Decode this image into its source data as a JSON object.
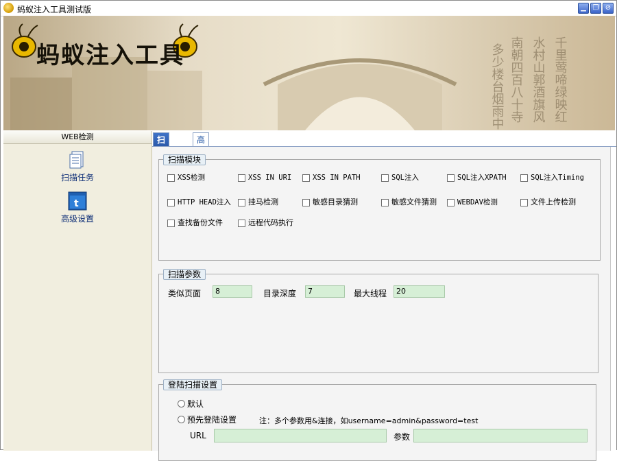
{
  "window": {
    "title": "蚂蚁注入工具测试版",
    "controls": [
      "minimize",
      "maximize",
      "close"
    ]
  },
  "banner": {
    "logo_text": "蚂蚁注入工具"
  },
  "sidebar": {
    "header": "WEB检测",
    "items": [
      {
        "label": "扫描任务",
        "icon": "document-icon"
      },
      {
        "label": "高级设置",
        "icon": "settings-window-icon"
      }
    ]
  },
  "tabs": [
    {
      "label": "扫描任务",
      "active": true
    },
    {
      "label": "高级设置",
      "active": false
    }
  ],
  "scan_modules": {
    "title": "扫描模块",
    "options": [
      "XSS检测",
      "XSS IN URI",
      "XSS IN PATH",
      "SQL注入",
      "SQL注入XPATH",
      "SQL注入Timing",
      "HTTP HEAD注入",
      "挂马检测",
      "敏感目录猜测",
      "敏感文件猜测",
      "WEBDAV检测",
      "文件上传检测",
      "查找备份文件",
      "远程代码执行"
    ]
  },
  "scan_params": {
    "title": "扫描参数",
    "similar_pages_label": "类似页面",
    "similar_pages_value": "8",
    "depth_label": "目录深度",
    "depth_value": "7",
    "threads_label": "最大线程",
    "threads_value": "20"
  },
  "login_scan": {
    "title": "登陆扫描设置",
    "radio_default": "默认",
    "radio_prelogin": "预先登陆设置",
    "note": "注：多个参数用&连接，如username=admin&password=test",
    "url_label": "URL",
    "url_value": "",
    "param_label": "参数",
    "param_value": ""
  },
  "colors": {
    "tab_active": "#2a58a9",
    "field_bg": "#d6efd6",
    "sidebar_bg": "#f1eedf"
  }
}
